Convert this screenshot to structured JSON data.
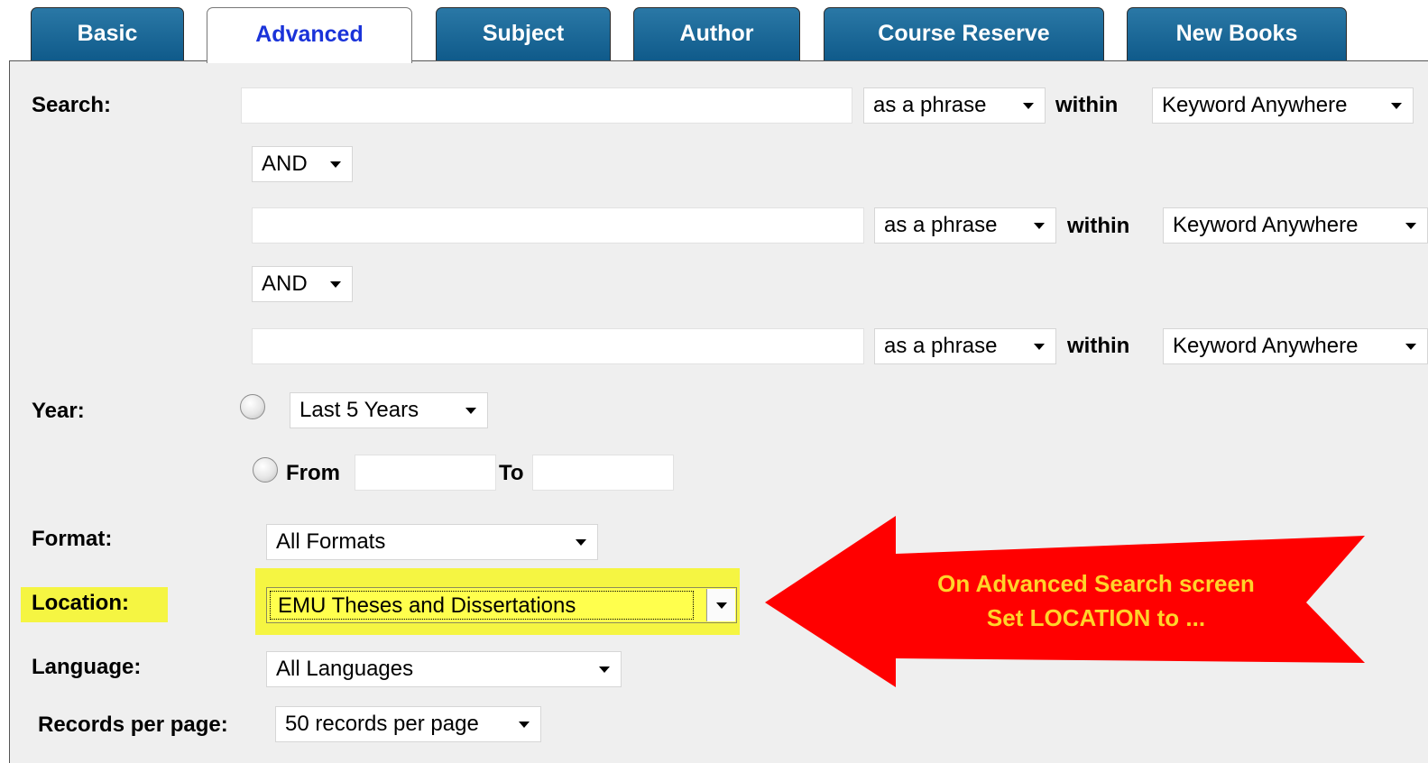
{
  "tabs": {
    "basic": "Basic",
    "advanced": "Advanced",
    "subject": "Subject",
    "author": "Author",
    "course_reserve": "Course Reserve",
    "new_books": "New Books"
  },
  "search": {
    "label": "Search:",
    "within_label": "within",
    "rows": [
      {
        "value": "",
        "match": "as a phrase",
        "field": "Keyword Anywhere"
      },
      {
        "value": "",
        "match": "as a phrase",
        "field": "Keyword Anywhere"
      },
      {
        "value": "",
        "match": "as a phrase",
        "field": "Keyword Anywhere"
      }
    ],
    "operators": [
      "AND",
      "AND"
    ]
  },
  "year": {
    "label": "Year:",
    "range_option": "Last 5 Years",
    "from_label": "From",
    "to_label": "To",
    "from_value": "",
    "to_value": ""
  },
  "format": {
    "label": "Format:",
    "value": "All Formats"
  },
  "location": {
    "label": "Location:",
    "value": "EMU Theses and Dissertations"
  },
  "language": {
    "label": "Language:",
    "value": "All Languages"
  },
  "records": {
    "label": "Records per page:",
    "value": "50 records per page"
  },
  "annotation": {
    "line1": "On Advanced Search screen",
    "line2": "Set LOCATION to ...",
    "arrow_color": "#ff0000",
    "text_color": "#ffd42a",
    "highlight_color": "#f5f542"
  },
  "colors": {
    "tab_bg": "#1a6596",
    "active_tab_text": "#1a33d9",
    "panel_bg": "#efefef"
  }
}
